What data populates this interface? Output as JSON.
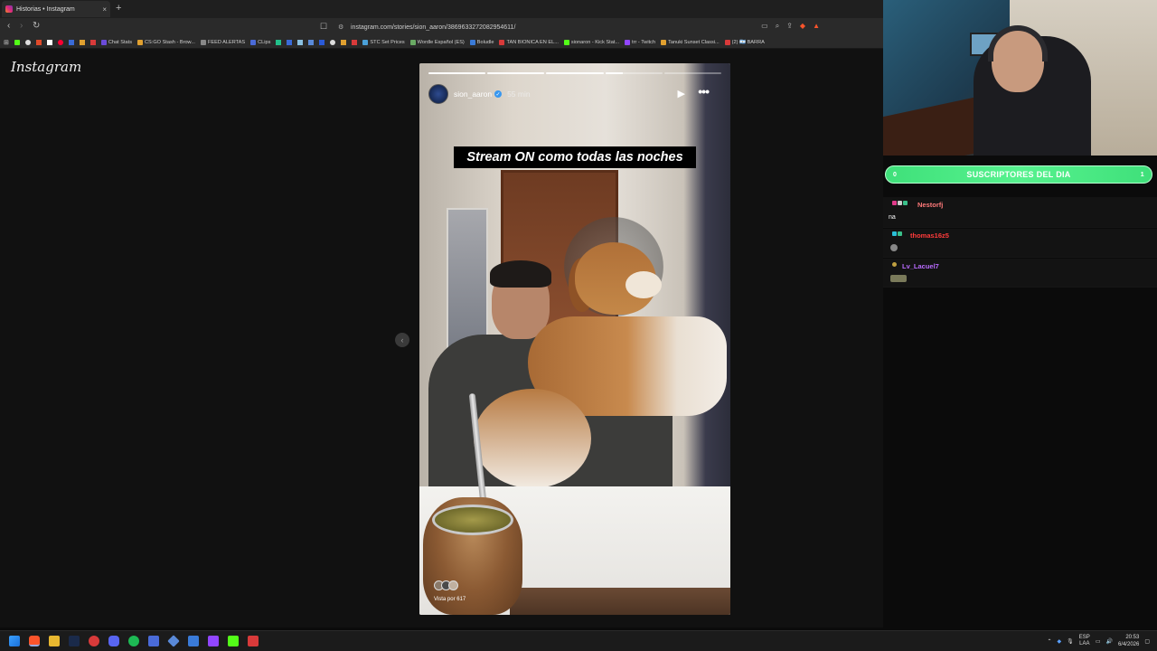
{
  "browser": {
    "tab_title": "Historias • Instagram",
    "tab_close": "×",
    "new_tab": "+",
    "url": "instagram.com/stories/sion_aaron/3869633272082954611/",
    "bookmarks": [
      {
        "label": "Chat Stats",
        "color": "#6b4bd8"
      },
      {
        "label": "CS:GO Stash - Brow...",
        "color": "#e0a030"
      },
      {
        "label": "FEED ALERTAS",
        "color": "#888888"
      },
      {
        "label": "CLips",
        "color": "#4a6bd8"
      },
      {
        "label": "STC Set Prices",
        "color": "#4aa0d8"
      },
      {
        "label": "Wordle Español (ES)",
        "color": "#6aaa64"
      },
      {
        "label": "Boludle",
        "color": "#3a7bd8"
      },
      {
        "label": "TAN BIONICA EN EL...",
        "color": "#d83a3a"
      },
      {
        "label": "sionaron - Kick Stat...",
        "color": "#53fc18"
      },
      {
        "label": "trr - Twitch",
        "color": "#9146ff"
      },
      {
        "label": "Tanuki Sunset Classi...",
        "color": "#e0a030"
      },
      {
        "label": "(2) 🇦🇷 BARRA",
        "color": "#d83a3a"
      }
    ]
  },
  "instagram": {
    "logo": "Instagram",
    "prev_arrow": "‹",
    "story": {
      "username": "sion_aaron",
      "verified_mark": "✓",
      "time": "55 min",
      "caption": "Stream ON como todas las noches",
      "views": "Vista por 617",
      "play_icon": "▶",
      "more_icon": "•••",
      "progress": [
        1,
        1,
        1,
        0.3,
        0
      ]
    }
  },
  "overlay": {
    "sub_banner": {
      "left_count": "0",
      "label": "SUSCRIPTORES DEL DIA",
      "right_count": "1"
    },
    "chat": [
      {
        "user": "Nestorfj",
        "color": "#ff7a7a",
        "message": "na"
      },
      {
        "user": "thomas16z5",
        "color": "#ff3b3b",
        "message": ""
      },
      {
        "user": "Lv_Lacuel7",
        "color": "#b96bff",
        "message": ""
      }
    ]
  },
  "taskbar": {
    "lang_top": "ESP",
    "lang_bottom": "LAA",
    "time": "20:53",
    "date": "6/4/2026"
  }
}
